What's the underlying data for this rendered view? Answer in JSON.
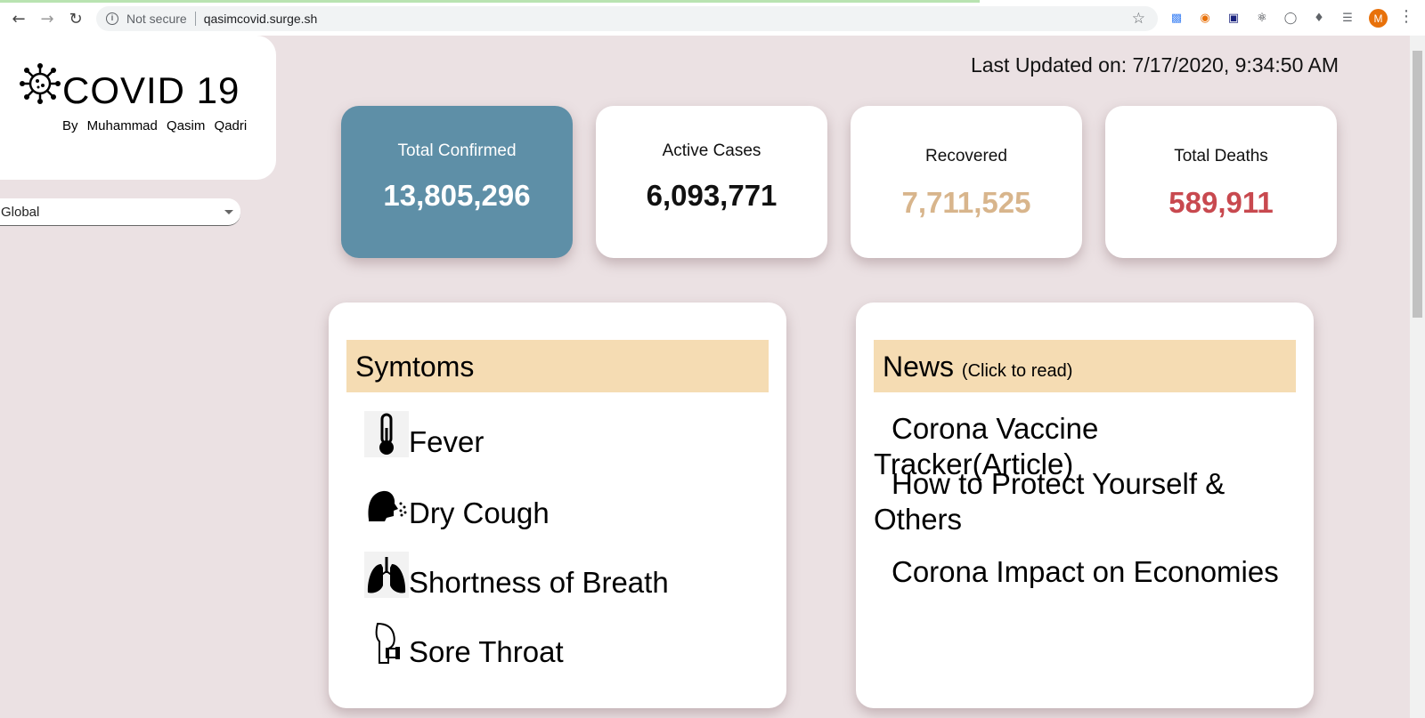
{
  "browser": {
    "security_label": "Not secure",
    "url": "qasimcovid.surge.sh",
    "avatar_letter": "M"
  },
  "brand": {
    "title": "COVID 19",
    "byline": "By Muhammad Qasim Qadri"
  },
  "country_select": {
    "value": "Global"
  },
  "last_updated": "Last Updated on: 7/17/2020, 9:34:50 AM",
  "stats": [
    {
      "label": "Total Confirmed",
      "value": "13,805,296",
      "color": "#ffffff"
    },
    {
      "label": "Active Cases",
      "value": "6,093,771",
      "color": "#111111"
    },
    {
      "label": "Recovered",
      "value": "7,711,525",
      "color": "#d8b58c"
    },
    {
      "label": "Total Deaths",
      "value": "589,911",
      "color": "#c8494f"
    }
  ],
  "symptoms": {
    "heading": "Symtoms",
    "items": [
      {
        "label": "Fever",
        "icon": "thermometer-icon"
      },
      {
        "label": "Dry Cough",
        "icon": "cough-icon"
      },
      {
        "label": "Shortness of Breath",
        "icon": "lungs-icon"
      },
      {
        "label": "Sore Throat",
        "icon": "throat-icon"
      }
    ]
  },
  "news": {
    "heading": "News",
    "subheading": "(Click to read)",
    "items": [
      "Corona Vaccine Tracker(Article)",
      "How to Protect Yourself & Others",
      "Corona Impact on Economies"
    ]
  },
  "colors": {
    "page_bg": "#ebe1e3",
    "primary_card": "#5e8fa7",
    "header_band": "#f5dcb3"
  }
}
